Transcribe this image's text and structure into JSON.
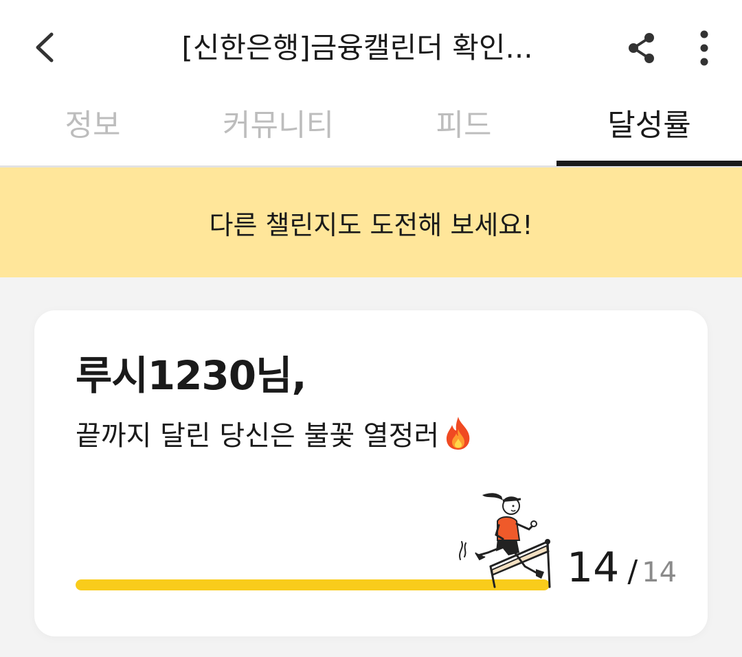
{
  "header": {
    "title": "[신한은행]금융캘린더 확인...",
    "back_icon": "chevron-left-icon",
    "share_icon": "share-icon",
    "more_icon": "more-vertical-icon"
  },
  "tabs": [
    {
      "label": "정보",
      "active": false
    },
    {
      "label": "커뮤니티",
      "active": false
    },
    {
      "label": "피드",
      "active": false
    },
    {
      "label": "달성률",
      "active": true
    }
  ],
  "banner": {
    "text": "다른 챌린지도 도전해 보세요!",
    "color": "#ffe69a"
  },
  "card": {
    "greeting": "루시1230님,",
    "message": "끝까지 달린 당신은 불꽃 열정러",
    "message_icon": "fire-icon",
    "progress": {
      "current": "14",
      "separator": "/",
      "total": "14",
      "fraction": 1.0,
      "color": "#f9cc1b"
    },
    "illustration": "runner-hurdle-illustration"
  }
}
